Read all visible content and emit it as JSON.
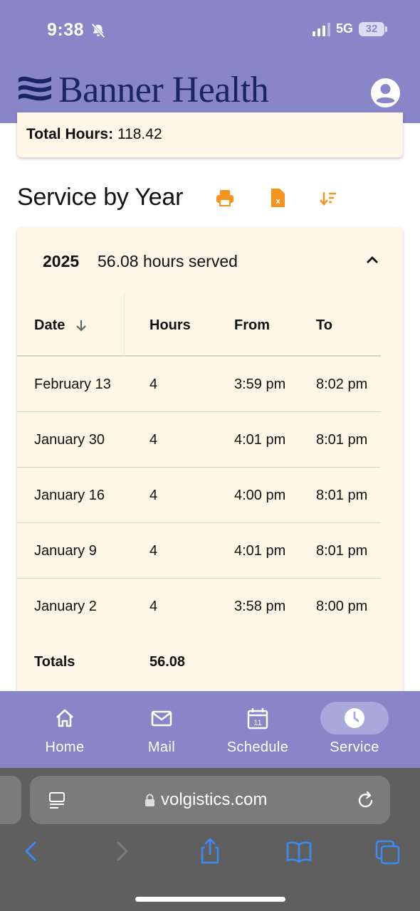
{
  "status_bar": {
    "time": "9:38",
    "network": "5G",
    "battery": "32"
  },
  "header": {
    "brand": "Banner Health"
  },
  "summary": {
    "label": "Total Hours:",
    "value": "118.42"
  },
  "service": {
    "title": "Service by Year",
    "year": "2025",
    "hours_served": "56.08 hours served",
    "columns": [
      "Date",
      "Hours",
      "From",
      "To"
    ],
    "rows": [
      {
        "date": "February 13",
        "hours": "4",
        "from": "3:59 pm",
        "to": "8:02 pm"
      },
      {
        "date": "January 30",
        "hours": "4",
        "from": "4:01 pm",
        "to": "8:01 pm"
      },
      {
        "date": "January 16",
        "hours": "4",
        "from": "4:00 pm",
        "to": "8:01 pm"
      },
      {
        "date": "January 9",
        "hours": "4",
        "from": "4:01 pm",
        "to": "8:01 pm"
      },
      {
        "date": "January 2",
        "hours": "4",
        "from": "3:58 pm",
        "to": "8:00 pm"
      }
    ],
    "totals_label": "Totals",
    "totals_hours": "56.08"
  },
  "nav": {
    "home": "Home",
    "mail": "Mail",
    "schedule": "Schedule",
    "schedule_day": "11",
    "service": "Service",
    "active": "service"
  },
  "browser": {
    "url": "volgistics.com"
  },
  "colors": {
    "header_bg": "#8886c8",
    "card_bg": "#fef6e6",
    "accent_orange": "#f7941d",
    "brand_navy": "#1a2466",
    "browser_bg": "#5f5f5f",
    "link_blue": "#3d8bf2"
  }
}
